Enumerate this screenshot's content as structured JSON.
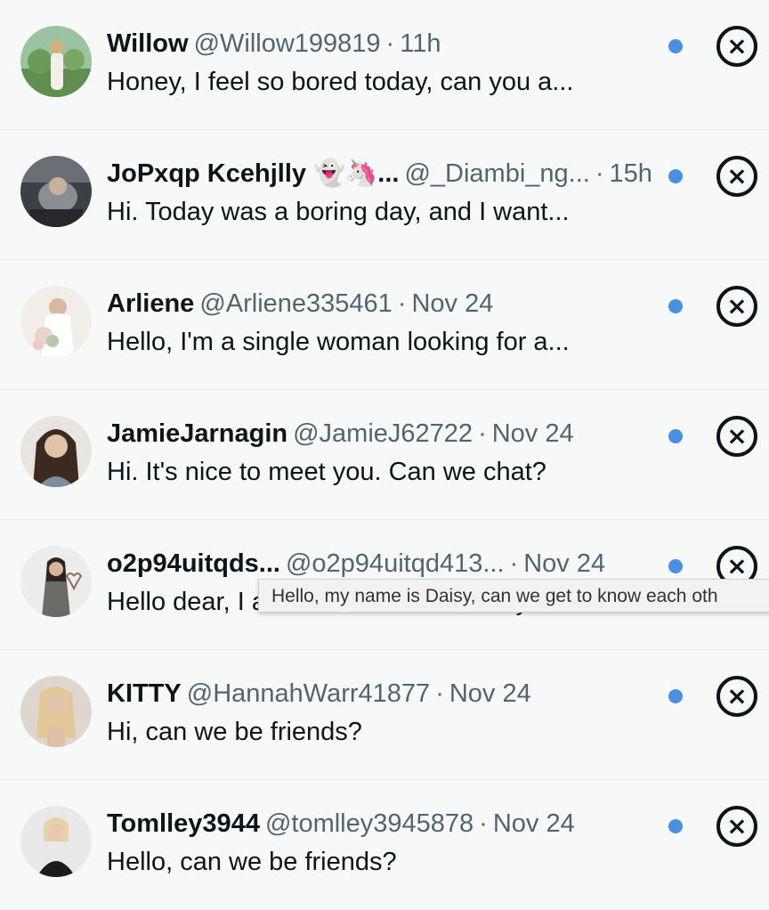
{
  "colors": {
    "accent": "#1d9bf0",
    "unread_dot": "#4a90e2"
  },
  "close_icon": "×",
  "messages": [
    {
      "name": "Willow",
      "handle": "@Willow199819",
      "sep": "·",
      "time": "11h",
      "preview": "Honey, I feel so bored today, can you a..."
    },
    {
      "name": "JoPxqp Kcehjlly 👻🦄...",
      "handle": "@_Diambi_ng...",
      "sep": "·",
      "time": "15h",
      "preview": "Hi. Today was a boring day, and I want..."
    },
    {
      "name": "Arliene",
      "handle": "@Arliene335461",
      "sep": "·",
      "time": "Nov 24",
      "preview": "Hello, I'm a single woman looking for a..."
    },
    {
      "name": "JamieJarnagin",
      "handle": "@JamieJ62722",
      "sep": "·",
      "time": "Nov 24",
      "preview": "Hi. It's nice to meet you. Can we chat?"
    },
    {
      "name": "o2p94uitqds...",
      "handle": "@o2p94uitqd413...",
      "sep": "·",
      "time": "Nov 24",
      "preview": "Hello dear, I am in a bad mood today. ..."
    },
    {
      "name": "KITTY",
      "handle": "@HannahWarr41877",
      "sep": "·",
      "time": "Nov 24",
      "preview": "Hi, can we be friends?"
    },
    {
      "name": "Tomlley3944",
      "handle": "@tomlley3945878",
      "sep": "·",
      "time": "Nov 24",
      "preview": "Hello, can we be friends?"
    }
  ],
  "tooltip": "Hello, my name is Daisy, can we get to know each oth"
}
